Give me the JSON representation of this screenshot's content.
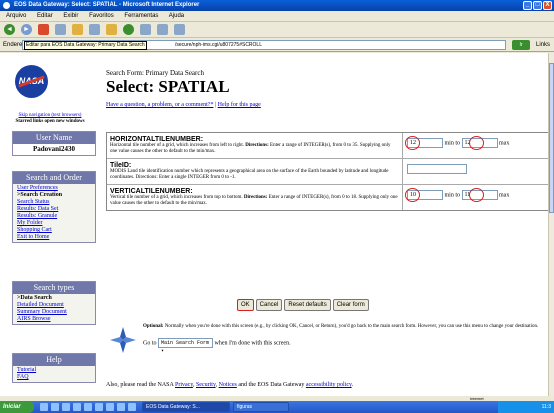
{
  "window": {
    "title": "EOS Data Gateway: Select: SPATIAL - Microsoft Internet Explorer",
    "controls": [
      "_",
      "□",
      "X"
    ]
  },
  "menu": [
    "Arquivo",
    "Editar",
    "Exibir",
    "Favoritos",
    "Ferramentas",
    "Ajuda"
  ],
  "toolbar": {
    "back": "◄",
    "forward": "►"
  },
  "address": {
    "label": "Endereço",
    "tooltip": "Editar para EOS Data Gateway: Primary Data Search",
    "url": "/secure/nph-ims.cgi/u807275#SCROLL",
    "go": "Ir",
    "links": "Links"
  },
  "sidebar": {
    "logo": "NASA",
    "skip_link": "Skip navigation (text browsers)",
    "starred": "Starred links open new windows",
    "user_header": "User Name",
    "user_name": "Padovani2430",
    "search_header": "Search and Order",
    "search_items": [
      "User Preferences",
      ">Search Creation",
      "Search Status",
      "Results: Data Set",
      "Results: Granule",
      "My Folder",
      "Shopping Cart",
      "Exit to Home"
    ],
    "types_header": "Search types",
    "types_items": [
      ">Data Search",
      "Detailed Document",
      "Summary Document",
      "AIRS Browse"
    ],
    "help_header": "Help",
    "help_items": [
      "Tutorial",
      "FAQ"
    ]
  },
  "main": {
    "form_label": "Search Form: Primary Data Search",
    "title": "Select: SPATIAL",
    "question_link": "Have a question, a problem, or a comment?*",
    "separator": "|",
    "help_link": "Help for this page"
  },
  "fields": {
    "htile": {
      "heading": "HORIZONTALTILENUMBER:",
      "text_a": "Horizontal tile number of a grid, which increases from left to right. ",
      "directions": "Directions:",
      "text_b": " Enter a range of INTEGER(s), from 0 to 35. Supplying only one value causes the other to default to the min/max.",
      "min_value": "12",
      "max_value": "12",
      "min_to": "min to",
      "max_label": "max"
    },
    "tileid": {
      "heading": "TileID:",
      "text": "MODIS Land tile identification number which represents a geographical area on the surface of the Earth bounded by latitude and longitude coordinates. Directions: Enter a single INTEGER from 0 to -1."
    },
    "vtile": {
      "heading": "VERTICALTILENUMBER:",
      "text_a": "Vertical tile number of a grid, which increases from top to bottom. ",
      "directions": "Directions:",
      "text_b": " Enter a range of INTEGER(s), from 0 to 18. Supplying only one value causes the other to default to the min/max.",
      "min_value": "10",
      "max_value": "11",
      "min_to": "min to",
      "max_label": "max"
    }
  },
  "buttons": {
    "ok": "OK",
    "cancel": "Cancel",
    "reset": "Reset defaults",
    "clear": "Clear form"
  },
  "optional": {
    "label": "Optional:",
    "text": " Normally when you're done with this screen (e.g., by clicking OK, Cancel, or Return), you'd go back to the main search form. However, you can use this menu to change your destination.",
    "goto_prefix": "Go to",
    "goto_value": "Main Search Form",
    "goto_suffix": "when I'm done with this screen."
  },
  "policy": {
    "prefix": "Also, please read the NASA ",
    "privacy": "Privacy",
    "security": "Security",
    "notices": "Notices",
    "middle": " and the EOS Data Gateway ",
    "accessibility": "accessibility policy",
    "end": "."
  },
  "statusbar": {
    "zone": "Internet"
  },
  "taskbar": {
    "start": "Iniciar",
    "tasks": [
      "EOS Data Gateway: S...",
      "figuras"
    ],
    "clock": "11:3"
  }
}
